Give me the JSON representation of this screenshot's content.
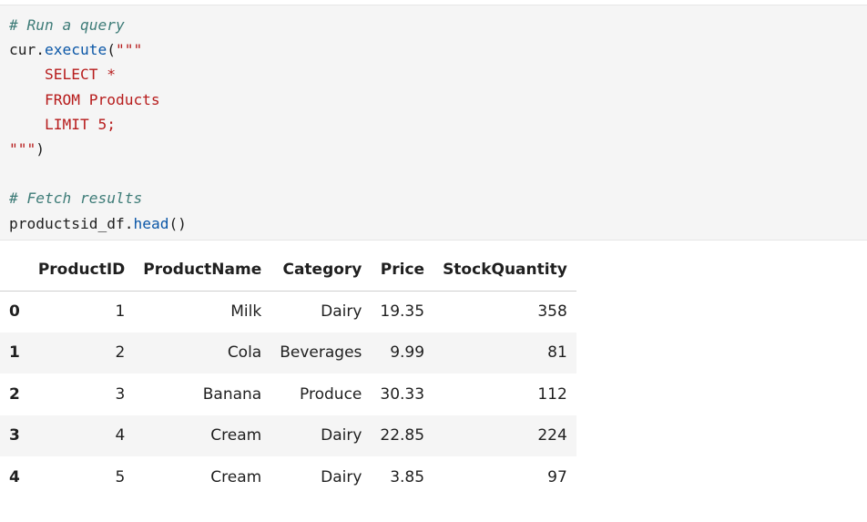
{
  "code_cell": {
    "lines": [
      [
        {
          "t": "# Run a query",
          "c": "comment"
        }
      ],
      [
        {
          "t": "cur.",
          "c": "plain"
        },
        {
          "t": "execute",
          "c": "fn"
        },
        {
          "t": "(",
          "c": "plain"
        },
        {
          "t": "\"\"\"",
          "c": "str"
        }
      ],
      [
        {
          "t": "    SELECT *",
          "c": "str"
        }
      ],
      [
        {
          "t": "    FROM Products",
          "c": "str"
        }
      ],
      [
        {
          "t": "    LIMIT 5;",
          "c": "str"
        }
      ],
      [
        {
          "t": "\"\"\"",
          "c": "str"
        },
        {
          "t": ")",
          "c": "plain"
        }
      ],
      [],
      [
        {
          "t": "# Fetch results",
          "c": "comment"
        }
      ],
      [
        {
          "t": "productsid_df.",
          "c": "plain"
        },
        {
          "t": "head",
          "c": "fn"
        },
        {
          "t": "()",
          "c": "plain"
        }
      ]
    ]
  },
  "dataframe": {
    "index_header": "",
    "columns": [
      "ProductID",
      "ProductName",
      "Category",
      "Price",
      "StockQuantity"
    ],
    "rows": [
      {
        "index": "0",
        "cells": [
          "1",
          "Milk",
          "Dairy",
          "19.35",
          "358"
        ]
      },
      {
        "index": "1",
        "cells": [
          "2",
          "Cola",
          "Beverages",
          "9.99",
          "81"
        ]
      },
      {
        "index": "2",
        "cells": [
          "3",
          "Banana",
          "Produce",
          "30.33",
          "112"
        ]
      },
      {
        "index": "3",
        "cells": [
          "4",
          "Cream",
          "Dairy",
          "22.85",
          "224"
        ]
      },
      {
        "index": "4",
        "cells": [
          "5",
          "Cream",
          "Dairy",
          "3.85",
          "97"
        ]
      }
    ]
  },
  "colors": {
    "comment": "#3e7c78",
    "function": "#0b57a7",
    "string": "#b71c1c",
    "cell_background": "#f5f5f5"
  }
}
